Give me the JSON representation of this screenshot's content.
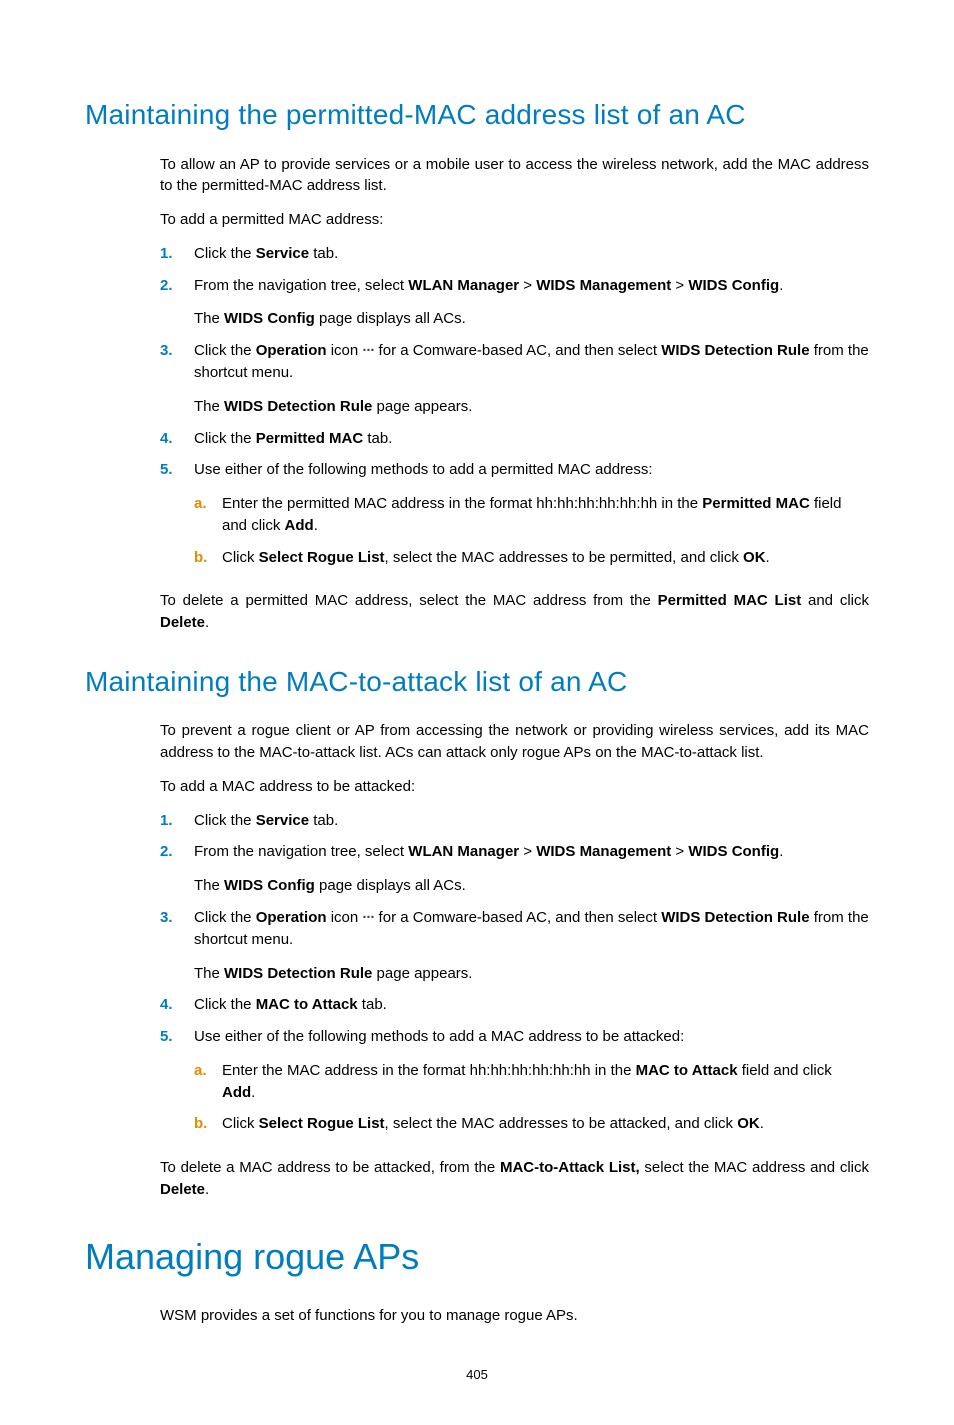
{
  "page_number": "405",
  "section1": {
    "heading": "Maintaining the permitted-MAC address list of an AC",
    "intro": "To allow an AP to provide services or a mobile user to access the wireless network, add the MAC address to the permitted-MAC address list.",
    "lead": "To add a permitted MAC address:",
    "step1_pre": "Click the ",
    "step1_b": "Service",
    "step1_post": " tab.",
    "step2_pre": "From the navigation tree, select ",
    "step2_b1": "WLAN Manager",
    "step2_sep": " > ",
    "step2_b2": "WIDS Management",
    "step2_b3": "WIDS Config",
    "step2_end": ".",
    "step2_line2_pre": "The ",
    "step2_line2_b": "WIDS Config",
    "step2_line2_post": " page displays all ACs.",
    "step3_pre": "Click the ",
    "step3_b1": "Operation",
    "step3_mid1": " icon ",
    "step3_dots": "···",
    "step3_mid2": " for a Comware-based AC, and then select ",
    "step3_b2": "WIDS Detection Rule",
    "step3_post": " from the shortcut menu.",
    "step3_line2_pre": "The ",
    "step3_line2_b": "WIDS Detection Rule",
    "step3_line2_post": " page appears.",
    "step4_pre": "Click the ",
    "step4_b": "Permitted MAC",
    "step4_post": " tab.",
    "step5": "Use either of the following methods to add a permitted MAC address:",
    "step5a_pre": "Enter the permitted MAC address in the format hh:hh:hh:hh:hh:hh in the ",
    "step5a_b1": "Permitted MAC",
    "step5a_mid": " field and click ",
    "step5a_b2": "Add",
    "step5a_end": ".",
    "step5b_pre": "Click ",
    "step5b_b1": "Select Rogue List",
    "step5b_mid": ", select the MAC addresses to be permitted, and click ",
    "step5b_b2": "OK",
    "step5b_end": ".",
    "outro_pre": "To delete a permitted MAC address, select the MAC address from the ",
    "outro_b1": "Permitted MAC List",
    "outro_mid": " and click ",
    "outro_b2": "Delete",
    "outro_end": "."
  },
  "section2": {
    "heading": "Maintaining the MAC-to-attack list of an AC",
    "intro": "To prevent a rogue client or AP from accessing the network or providing wireless services, add its MAC address to the MAC-to-attack list. ACs can attack only rogue APs on the MAC-to-attack list.",
    "lead": "To add a MAC address to be attacked:",
    "step1_pre": "Click the ",
    "step1_b": "Service",
    "step1_post": " tab.",
    "step2_pre": "From the navigation tree, select ",
    "step2_b1": "WLAN Manager",
    "step2_sep": " > ",
    "step2_b2": "WIDS Management",
    "step2_b3": "WIDS Config",
    "step2_end": ".",
    "step2_line2_pre": "The ",
    "step2_line2_b": "WIDS Config",
    "step2_line2_post": " page displays all ACs.",
    "step3_pre": "Click the ",
    "step3_b1": "Operation",
    "step3_mid1": " icon ",
    "step3_dots": "···",
    "step3_mid2": " for a Comware-based AC, and then select ",
    "step3_b2": "WIDS Detection Rule",
    "step3_post": " from the shortcut menu.",
    "step3_line2_pre": "The ",
    "step3_line2_b": "WIDS Detection Rule",
    "step3_line2_post": " page appears.",
    "step4_pre": "Click the ",
    "step4_b": "MAC to Attack",
    "step4_post": " tab.",
    "step5": "Use either of the following methods to add a MAC address to be attacked:",
    "step5a_pre": "Enter the MAC address in the format hh:hh:hh:hh:hh:hh in the ",
    "step5a_b1": "MAC to Attack",
    "step5a_mid": " field and click ",
    "step5a_b2": "Add",
    "step5a_end": ".",
    "step5b_pre": "Click ",
    "step5b_b1": "Select Rogue List",
    "step5b_mid": ", select the MAC addresses to be attacked, and click ",
    "step5b_b2": "OK",
    "step5b_end": ".",
    "outro_pre": "To delete a MAC address to be attacked, from the ",
    "outro_b1": "MAC-to-Attack List,",
    "outro_mid": " select the MAC address and click ",
    "outro_b2": "Delete",
    "outro_end": "."
  },
  "section3": {
    "heading": "Managing rogue APs",
    "intro": "WSM provides a set of functions for you to manage rogue APs."
  }
}
